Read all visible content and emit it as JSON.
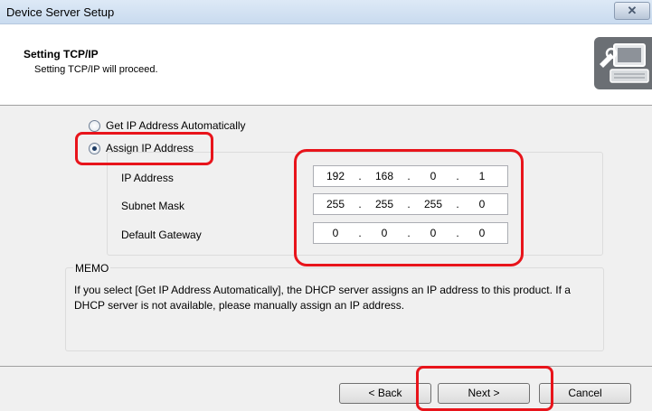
{
  "window": {
    "title": "Device Server Setup",
    "close_glyph": "✕"
  },
  "header": {
    "title": "Setting TCP/IP",
    "subtitle": "Setting TCP/IP will proceed.",
    "icon": "computer-settings-icon"
  },
  "options": {
    "auto_label": "Get IP Address Automatically",
    "assign_label": "Assign IP Address",
    "selected": "assign"
  },
  "fields": {
    "ip_label": "IP Address",
    "ip": [
      "192",
      "168",
      "0",
      "1"
    ],
    "subnet_label": "Subnet Mask",
    "subnet": [
      "255",
      "255",
      "255",
      "0"
    ],
    "gateway_label": "Default Gateway",
    "gateway": [
      "0",
      "0",
      "0",
      "0"
    ]
  },
  "memo": {
    "label": "MEMO",
    "text": "If you select [Get IP Address Automatically], the DHCP server assigns an IP address to this product. If a DHCP server is not available, please manually assign an IP address."
  },
  "buttons": {
    "back": "< Back",
    "next": "Next >",
    "cancel": "Cancel"
  },
  "colors": {
    "highlight": "#e8141b"
  }
}
